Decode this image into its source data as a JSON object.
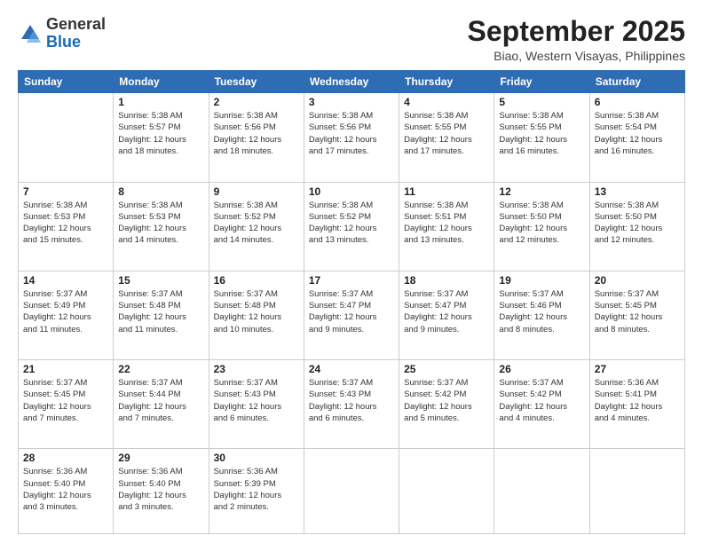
{
  "logo": {
    "general": "General",
    "blue": "Blue"
  },
  "title": "September 2025",
  "subtitle": "Biao, Western Visayas, Philippines",
  "weekdays": [
    "Sunday",
    "Monday",
    "Tuesday",
    "Wednesday",
    "Thursday",
    "Friday",
    "Saturday"
  ],
  "weeks": [
    [
      {
        "day": "",
        "info": ""
      },
      {
        "day": "1",
        "info": "Sunrise: 5:38 AM\nSunset: 5:57 PM\nDaylight: 12 hours\nand 18 minutes."
      },
      {
        "day": "2",
        "info": "Sunrise: 5:38 AM\nSunset: 5:56 PM\nDaylight: 12 hours\nand 18 minutes."
      },
      {
        "day": "3",
        "info": "Sunrise: 5:38 AM\nSunset: 5:56 PM\nDaylight: 12 hours\nand 17 minutes."
      },
      {
        "day": "4",
        "info": "Sunrise: 5:38 AM\nSunset: 5:55 PM\nDaylight: 12 hours\nand 17 minutes."
      },
      {
        "day": "5",
        "info": "Sunrise: 5:38 AM\nSunset: 5:55 PM\nDaylight: 12 hours\nand 16 minutes."
      },
      {
        "day": "6",
        "info": "Sunrise: 5:38 AM\nSunset: 5:54 PM\nDaylight: 12 hours\nand 16 minutes."
      }
    ],
    [
      {
        "day": "7",
        "info": "Sunrise: 5:38 AM\nSunset: 5:53 PM\nDaylight: 12 hours\nand 15 minutes."
      },
      {
        "day": "8",
        "info": "Sunrise: 5:38 AM\nSunset: 5:53 PM\nDaylight: 12 hours\nand 14 minutes."
      },
      {
        "day": "9",
        "info": "Sunrise: 5:38 AM\nSunset: 5:52 PM\nDaylight: 12 hours\nand 14 minutes."
      },
      {
        "day": "10",
        "info": "Sunrise: 5:38 AM\nSunset: 5:52 PM\nDaylight: 12 hours\nand 13 minutes."
      },
      {
        "day": "11",
        "info": "Sunrise: 5:38 AM\nSunset: 5:51 PM\nDaylight: 12 hours\nand 13 minutes."
      },
      {
        "day": "12",
        "info": "Sunrise: 5:38 AM\nSunset: 5:50 PM\nDaylight: 12 hours\nand 12 minutes."
      },
      {
        "day": "13",
        "info": "Sunrise: 5:38 AM\nSunset: 5:50 PM\nDaylight: 12 hours\nand 12 minutes."
      }
    ],
    [
      {
        "day": "14",
        "info": "Sunrise: 5:37 AM\nSunset: 5:49 PM\nDaylight: 12 hours\nand 11 minutes."
      },
      {
        "day": "15",
        "info": "Sunrise: 5:37 AM\nSunset: 5:48 PM\nDaylight: 12 hours\nand 11 minutes."
      },
      {
        "day": "16",
        "info": "Sunrise: 5:37 AM\nSunset: 5:48 PM\nDaylight: 12 hours\nand 10 minutes."
      },
      {
        "day": "17",
        "info": "Sunrise: 5:37 AM\nSunset: 5:47 PM\nDaylight: 12 hours\nand 9 minutes."
      },
      {
        "day": "18",
        "info": "Sunrise: 5:37 AM\nSunset: 5:47 PM\nDaylight: 12 hours\nand 9 minutes."
      },
      {
        "day": "19",
        "info": "Sunrise: 5:37 AM\nSunset: 5:46 PM\nDaylight: 12 hours\nand 8 minutes."
      },
      {
        "day": "20",
        "info": "Sunrise: 5:37 AM\nSunset: 5:45 PM\nDaylight: 12 hours\nand 8 minutes."
      }
    ],
    [
      {
        "day": "21",
        "info": "Sunrise: 5:37 AM\nSunset: 5:45 PM\nDaylight: 12 hours\nand 7 minutes."
      },
      {
        "day": "22",
        "info": "Sunrise: 5:37 AM\nSunset: 5:44 PM\nDaylight: 12 hours\nand 7 minutes."
      },
      {
        "day": "23",
        "info": "Sunrise: 5:37 AM\nSunset: 5:43 PM\nDaylight: 12 hours\nand 6 minutes."
      },
      {
        "day": "24",
        "info": "Sunrise: 5:37 AM\nSunset: 5:43 PM\nDaylight: 12 hours\nand 6 minutes."
      },
      {
        "day": "25",
        "info": "Sunrise: 5:37 AM\nSunset: 5:42 PM\nDaylight: 12 hours\nand 5 minutes."
      },
      {
        "day": "26",
        "info": "Sunrise: 5:37 AM\nSunset: 5:42 PM\nDaylight: 12 hours\nand 4 minutes."
      },
      {
        "day": "27",
        "info": "Sunrise: 5:36 AM\nSunset: 5:41 PM\nDaylight: 12 hours\nand 4 minutes."
      }
    ],
    [
      {
        "day": "28",
        "info": "Sunrise: 5:36 AM\nSunset: 5:40 PM\nDaylight: 12 hours\nand 3 minutes."
      },
      {
        "day": "29",
        "info": "Sunrise: 5:36 AM\nSunset: 5:40 PM\nDaylight: 12 hours\nand 3 minutes."
      },
      {
        "day": "30",
        "info": "Sunrise: 5:36 AM\nSunset: 5:39 PM\nDaylight: 12 hours\nand 2 minutes."
      },
      {
        "day": "",
        "info": ""
      },
      {
        "day": "",
        "info": ""
      },
      {
        "day": "",
        "info": ""
      },
      {
        "day": "",
        "info": ""
      }
    ]
  ]
}
